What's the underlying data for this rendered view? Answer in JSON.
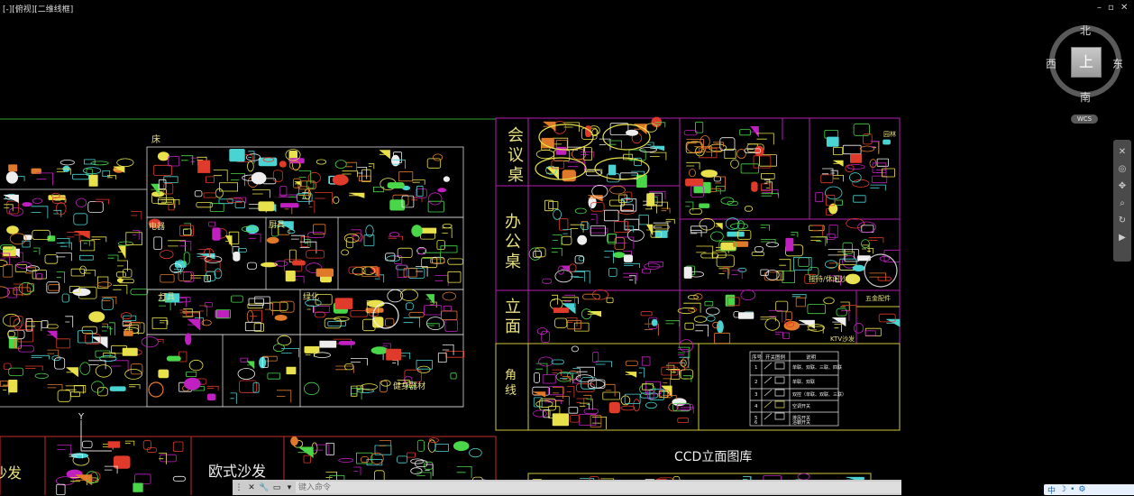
{
  "viewport": {
    "label": "[-][俯视][二维线框]"
  },
  "window_controls": {
    "minimize": "–",
    "restore": "▫",
    "close": "✕"
  },
  "viewcube": {
    "north": "北",
    "south": "南",
    "east": "东",
    "west": "西",
    "face": "上",
    "wcs": "WCS"
  },
  "labels": {
    "bed": "床",
    "conference": [
      "会",
      "议",
      "桌"
    ],
    "office": [
      "办",
      "公",
      "桌"
    ],
    "elevation": [
      "立",
      "面"
    ],
    "molding": [
      "角",
      "线"
    ],
    "electric": "电器",
    "kitchen": "厨具",
    "lamp": "灯具",
    "green": "绿化",
    "gym": "健身器材",
    "garden": "园林",
    "reception": "接待/休闲沙发",
    "hardware": "五金配件",
    "ktv": "KTV沙发",
    "euro_sofa": "欧式沙发",
    "sofa_left": "沙发",
    "ccd": "CCD立面图库"
  },
  "switch_table": {
    "headers": [
      "序号",
      "开关图例",
      "说明"
    ],
    "rows": [
      [
        "1",
        "",
        "单联、双联、三联、四联"
      ],
      [
        "2",
        "",
        "单联、双联"
      ],
      [
        "3",
        "",
        "双控（单联、双联、三联）"
      ],
      [
        "4",
        "",
        "空调开关"
      ],
      [
        "5",
        "",
        "排风开关"
      ],
      [
        "6",
        "",
        "浴霸开关"
      ]
    ]
  },
  "axis_label": "Y",
  "command": {
    "placeholder": "键入命令"
  },
  "tray": {
    "lang": "中",
    "moon": "☽",
    "dot": "•",
    "gear": "⚙"
  },
  "colors": {
    "yellow": "#e9e14c",
    "green": "#49d649",
    "cyan": "#4ad3d3",
    "magenta": "#c020c0",
    "red": "#e03a2a",
    "white": "#eeeeee",
    "orange": "#e07a2a"
  }
}
